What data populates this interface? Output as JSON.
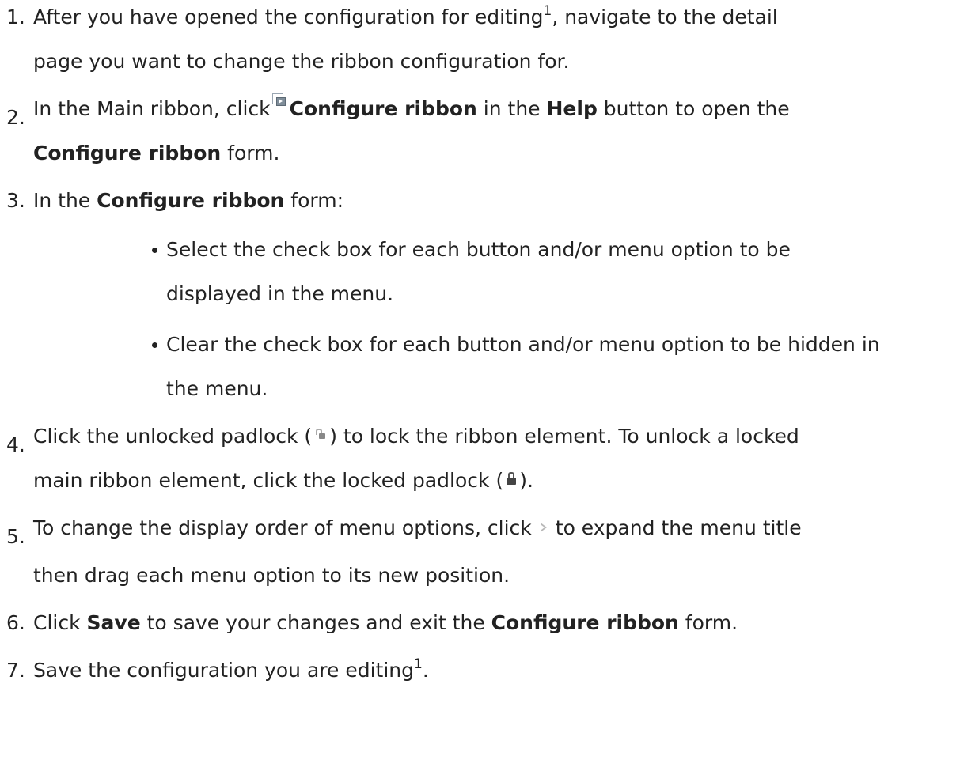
{
  "steps": [
    {
      "number": "1.",
      "text_a": "After you have opened the configuration for editing",
      "sup": "1",
      "text_b": ", navigate to the detail",
      "line2": "page you want to change the ribbon configuration for."
    },
    {
      "number": "2.",
      "text_a": "In the Main ribbon, click",
      "bold_a": "Configure ribbon",
      "text_b": " in the ",
      "bold_b": "Help",
      "text_c": " button to open the",
      "bold_c": "Configure ribbon",
      "text_d": " form."
    },
    {
      "number": "3.",
      "text_a": "In the ",
      "bold_a": "Configure ribbon",
      "text_b": " form:",
      "bullets": [
        {
          "line1": "Select the check box for each button and/or menu option to be",
          "line2": "displayed in the menu."
        },
        {
          "line1": "Clear the check box for each button and/or menu option to be hidden in",
          "line2": "the menu."
        }
      ]
    },
    {
      "number": "4.",
      "text_a": "Click the unlocked padlock (",
      "text_b": ") to lock the ribbon element. To unlock a locked",
      "text_c": "main ribbon element, click the locked padlock (",
      "text_d": ")."
    },
    {
      "number": "5.",
      "text_a": "To change the display order of menu options, click",
      "text_b": "to expand the menu title",
      "line2": "then drag each menu option to its new position."
    },
    {
      "number": "6.",
      "text_a": "Click ",
      "bold_a": "Save",
      "text_b": " to save your changes and exit the ",
      "bold_b": "Configure ribbon",
      "text_c": " form."
    },
    {
      "number": "7.",
      "text_a": "Save the configuration you are editing",
      "sup": "1",
      "text_b": "."
    }
  ],
  "icons": {
    "configure": "configure-ribbon-icon",
    "unlocked": "unlocked-padlock-icon",
    "locked": "locked-padlock-icon",
    "expand": "expand-arrow-icon"
  }
}
